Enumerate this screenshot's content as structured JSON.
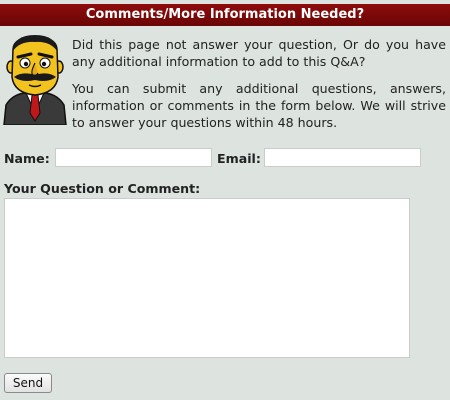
{
  "header": {
    "title": "Comments/More Information Needed?"
  },
  "intro": {
    "paragraph1": "Did this page not answer your question, Or do you have any additional information to add to this Q&A?",
    "paragraph2": "You can submit any additional questions, answers, information or comments in the form below. We will strive to answer your questions within 48 hours."
  },
  "form": {
    "name_label": "Name:",
    "name_value": "",
    "email_label": "Email:",
    "email_value": "",
    "comment_label": "Your Question or Comment:",
    "comment_value": "",
    "send_label": "Send"
  },
  "icons": {
    "avatar": "cartoon-man-mustache-icon"
  },
  "colors": {
    "header_bg": "#7a0a0a",
    "page_bg": "#dde3df"
  }
}
